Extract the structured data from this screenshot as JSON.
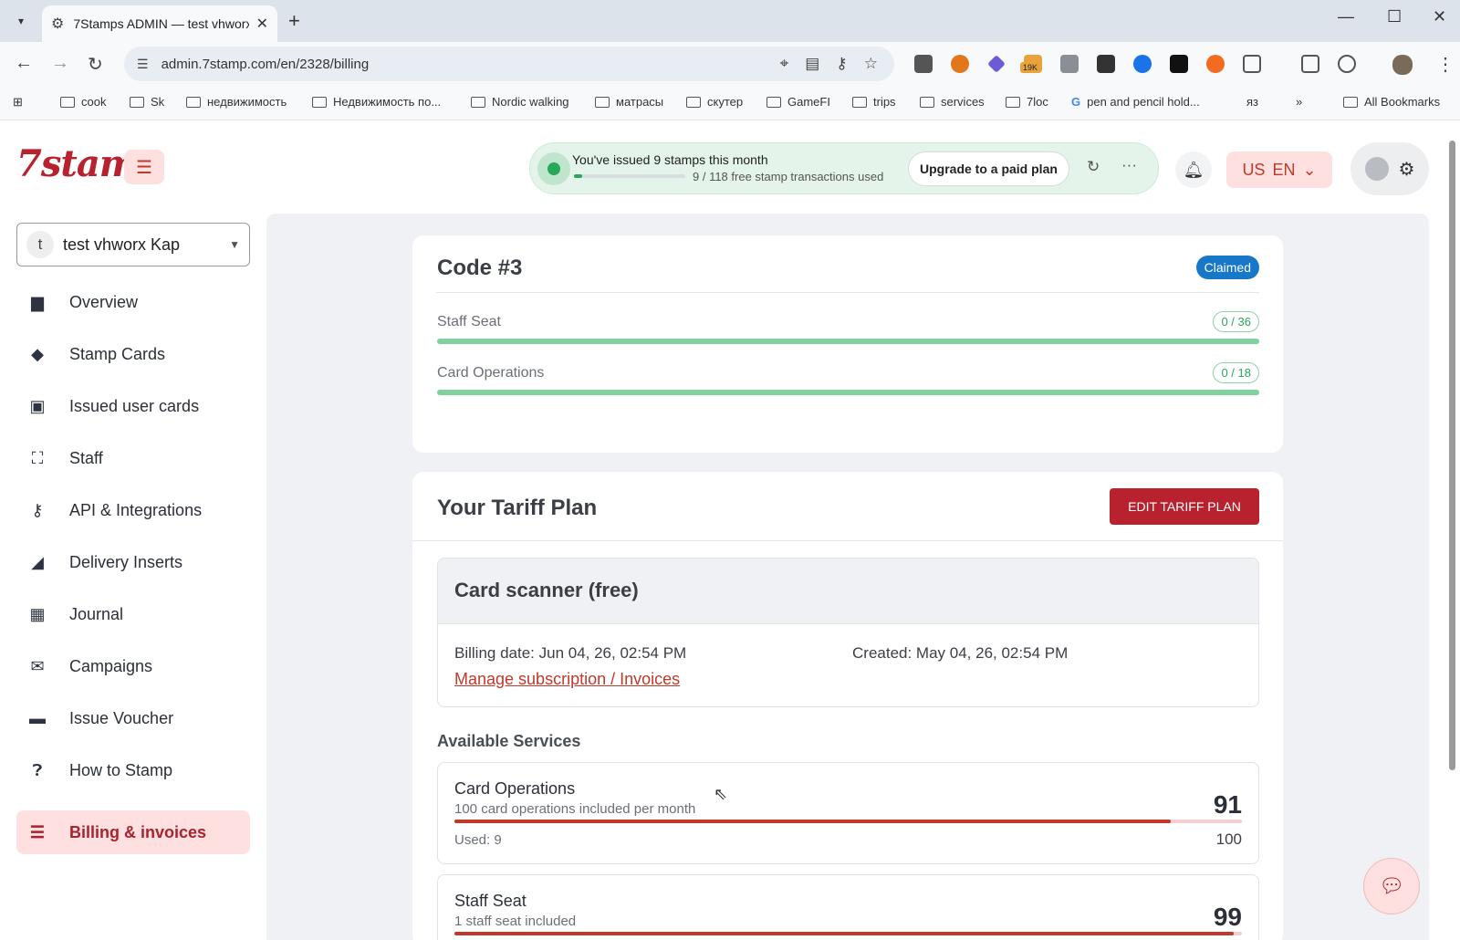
{
  "browser": {
    "tab_title": "7Stamps ADMIN — test vhworx",
    "url": "admin.7stamp.com/en/2328/billing",
    "bookmarks": [
      "cook",
      "Sk",
      "недвижимость",
      "Недвижимость по...",
      "Nordic walking",
      "матрасы",
      "скутер",
      "GameFI",
      "trips",
      "services",
      "7loc",
      "pen and pencil hold...",
      "яз"
    ],
    "all_bookmarks": "All Bookmarks",
    "extension_badge": "19K"
  },
  "header": {
    "logo": "7stamp",
    "promo_message": "You've issued 9 stamps this month",
    "promo_sub": "9 / 118 free stamp transactions used",
    "promo_progress": 0.076,
    "upgrade_label": "Upgrade to a paid plan",
    "lang_flag": "US",
    "lang": "EN"
  },
  "sidebar": {
    "company_initial": "t",
    "company_name": "test vhworx Kap",
    "items": [
      {
        "label": "Overview",
        "icon": "briefcase-icon"
      },
      {
        "label": "Stamp Cards",
        "icon": "tag-icon"
      },
      {
        "label": "Issued user cards",
        "icon": "id-card-icon"
      },
      {
        "label": "Staff",
        "icon": "staff-icon"
      },
      {
        "label": "API & Integrations",
        "icon": "key-icon"
      },
      {
        "label": "Delivery Inserts",
        "icon": "inserts-icon"
      },
      {
        "label": "Journal",
        "icon": "table-icon"
      },
      {
        "label": "Campaigns",
        "icon": "envelope-icon"
      },
      {
        "label": "Issue Voucher",
        "icon": "ticket-icon"
      },
      {
        "label": "How to Stamp",
        "icon": "question-icon"
      },
      {
        "label": "Billing & invoices",
        "icon": "list-icon",
        "active": true
      }
    ]
  },
  "code_card": {
    "title": "Code #3",
    "status": "Claimed",
    "resources": [
      {
        "label": "Staff Seat",
        "value": "0 / 36",
        "fill": 1.0
      },
      {
        "label": "Card Operations",
        "value": "0 / 18",
        "fill": 1.0
      }
    ]
  },
  "plan": {
    "title": "Your Tariff Plan",
    "edit_label": "EDIT TARIFF PLAN",
    "plan_name": "Card scanner (free)",
    "billing_date": "Billing date: Jun 04, 26, 02:54 PM",
    "created": "Created: May 04, 26, 02:54 PM",
    "manage_link": "Manage subscription / Invoices",
    "available_title": "Available Services",
    "services": [
      {
        "name": "Card Operations",
        "desc": "100 card operations included per month",
        "remaining": "91",
        "used": "Used: 9",
        "total": "100",
        "fill": 0.91
      },
      {
        "name": "Staff Seat",
        "desc": "1 staff seat included",
        "remaining": "99",
        "fill": 0.99
      }
    ]
  },
  "colors": {
    "brand": "#b8222e",
    "brand_light": "#fde0df",
    "success": "#27a85a",
    "claimed": "#1778c9"
  }
}
